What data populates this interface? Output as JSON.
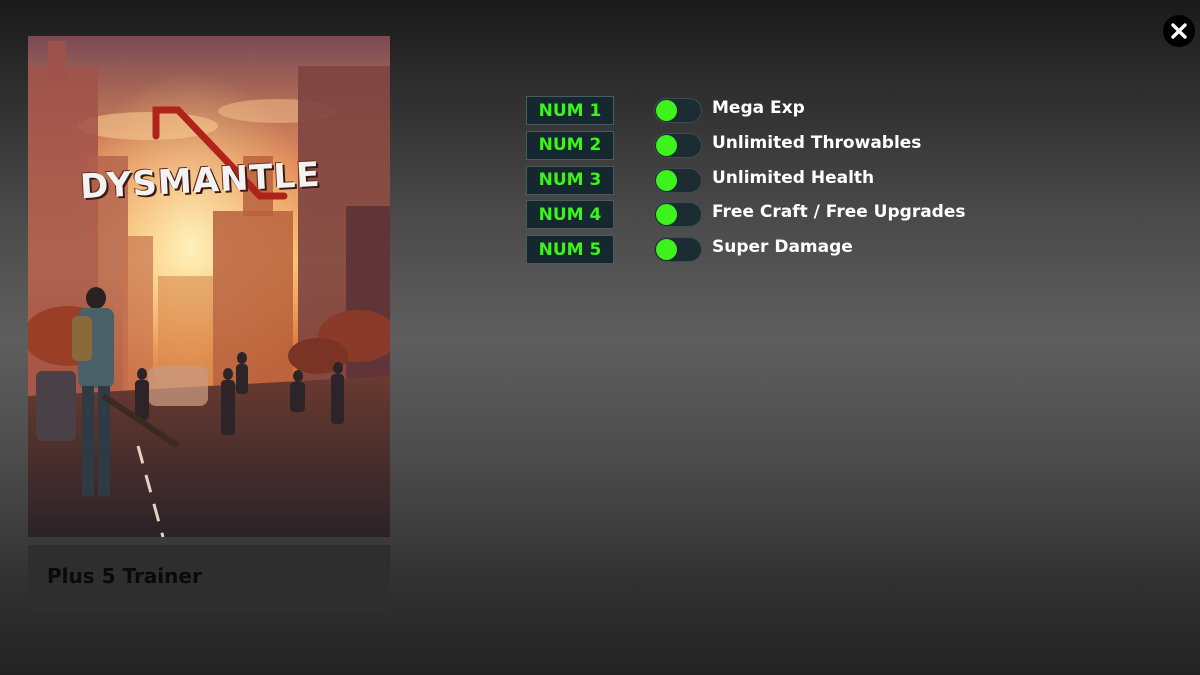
{
  "window": {
    "close_icon": "close-icon"
  },
  "game": {
    "title": "DYSMANTLE",
    "trainer_label": "Plus 5 Trainer",
    "cover_colors": {
      "sky": "#f0a050",
      "sun": "#ffe9a0",
      "buildings": "#8a4a38",
      "ground": "#3a2a2e"
    }
  },
  "theme": {
    "key_text_color": "#3af41a",
    "toggle_knob_color": "#3ef21c",
    "label_color": "#ffffff"
  },
  "cheats": [
    {
      "key": "NUM 1",
      "label": "Mega Exp",
      "enabled": true
    },
    {
      "key": "NUM 2",
      "label": "Unlimited Throwables",
      "enabled": true
    },
    {
      "key": "NUM 3",
      "label": "Unlimited Health",
      "enabled": true
    },
    {
      "key": "NUM 4",
      "label": "Free Craft / Free Upgrades",
      "enabled": true
    },
    {
      "key": "NUM 5",
      "label": "Super Damage",
      "enabled": true
    }
  ]
}
